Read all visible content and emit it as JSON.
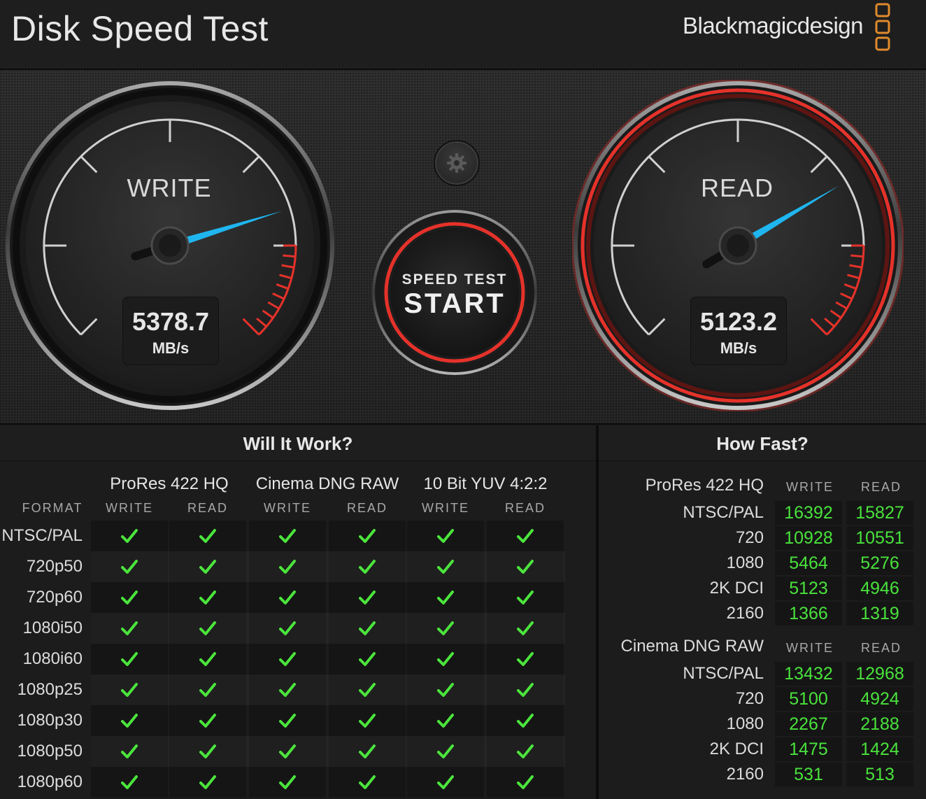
{
  "header": {
    "title": "Disk Speed Test",
    "brand": "Blackmagicdesign"
  },
  "gauges": {
    "write": {
      "label": "WRITE",
      "value": "5378.7",
      "unit": "MB/s",
      "needle_fraction": 0.77
    },
    "read": {
      "label": "READ",
      "value": "5123.2",
      "unit": "MB/s",
      "needle_fraction": 0.72
    }
  },
  "start_button": {
    "top_text": "SPEED TEST",
    "main_text": "START"
  },
  "will_it_work": {
    "heading": "Will It Work?",
    "format_label": "FORMAT",
    "groups": [
      {
        "name": "ProRes 422 HQ",
        "cols": [
          "WRITE",
          "READ"
        ]
      },
      {
        "name": "Cinema DNG RAW",
        "cols": [
          "WRITE",
          "READ"
        ]
      },
      {
        "name": "10 Bit YUV 4:2:2",
        "cols": [
          "WRITE",
          "READ"
        ]
      }
    ],
    "formats": [
      "NTSC/PAL",
      "720p50",
      "720p60",
      "1080i50",
      "1080i60",
      "1080p25",
      "1080p30",
      "1080p50",
      "1080p60"
    ]
  },
  "how_fast": {
    "heading": "How Fast?",
    "sections": [
      {
        "name": "ProRes 422 HQ",
        "write_label": "WRITE",
        "read_label": "READ",
        "rows": [
          {
            "label": "NTSC/PAL",
            "write": "16392",
            "read": "15827"
          },
          {
            "label": "720",
            "write": "10928",
            "read": "10551"
          },
          {
            "label": "1080",
            "write": "5464",
            "read": "5276"
          },
          {
            "label": "2K DCI",
            "write": "5123",
            "read": "4946"
          },
          {
            "label": "2160",
            "write": "1366",
            "read": "1319"
          }
        ]
      },
      {
        "name": "Cinema DNG RAW",
        "write_label": "WRITE",
        "read_label": "READ",
        "rows": [
          {
            "label": "NTSC/PAL",
            "write": "13432",
            "read": "12968"
          },
          {
            "label": "720",
            "write": "5100",
            "read": "4924"
          },
          {
            "label": "1080",
            "write": "2267",
            "read": "2188"
          },
          {
            "label": "2K DCI",
            "write": "1475",
            "read": "1424"
          },
          {
            "label": "2160",
            "write": "531",
            "read": "513"
          }
        ]
      }
    ]
  },
  "colors": {
    "accent_red": "#e5322a",
    "needle_blue": "#1fb6f0",
    "check_green": "#4be53c"
  },
  "icons": {
    "settings": "gear-icon",
    "check": "checkmark-icon",
    "brand_logo": "blackmagic-logo-icon"
  }
}
